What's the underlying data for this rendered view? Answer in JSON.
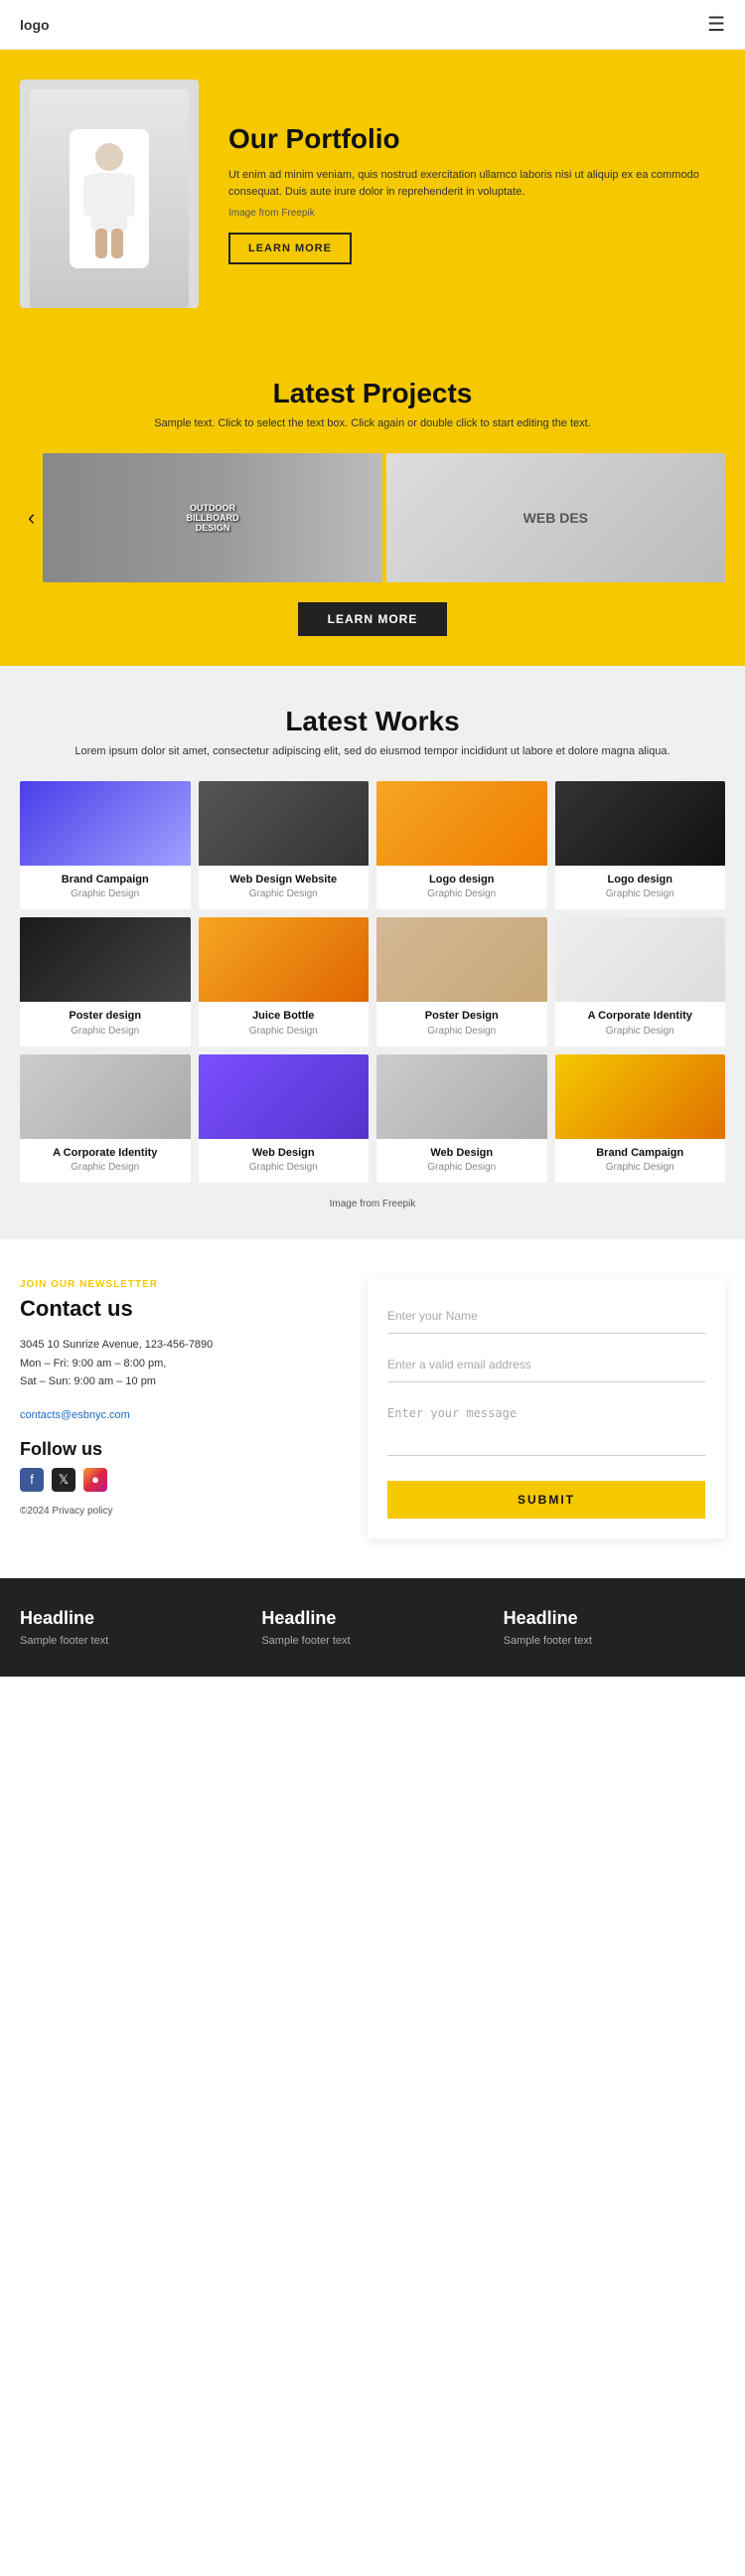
{
  "header": {
    "logo": "logo",
    "hamburger_icon": "☰"
  },
  "hero": {
    "title": "Our Portfolio",
    "text": "Ut enim ad minim veniam, quis nostrud exercitation ullamco laboris nisi ut aliquip ex ea commodo consequat. Duis aute irure dolor in reprehenderit in voluptate.",
    "freepik_text": "Image from Freepik",
    "button_label": "LEARN MORE"
  },
  "latest_projects": {
    "title": "Latest Projects",
    "subtitle": "Sample text. Click to select the text box. Click again or double click to start editing the text.",
    "button_label": "LEARN MORE"
  },
  "latest_works": {
    "title": "Latest Works",
    "subtitle": "Lorem ipsum dolor sit amet, consectetur adipiscing elit, sed do eiusmod tempor incididunt ut labore et dolore magna aliqua.",
    "freepik_text": "Image from Freepik",
    "cards": [
      {
        "title": "Brand Campaign",
        "sub": "Graphic Design",
        "img_class": "img-brand-campaign"
      },
      {
        "title": "Web Design Website",
        "sub": "Graphic Design",
        "img_class": "img-web-design-site"
      },
      {
        "title": "Logo design",
        "sub": "Graphic Design",
        "img_class": "img-logo-design"
      },
      {
        "title": "Logo design",
        "sub": "Graphic Design",
        "img_class": "img-logo-design2"
      },
      {
        "title": "Poster design",
        "sub": "Graphic Design",
        "img_class": "img-poster"
      },
      {
        "title": "Juice Bottle",
        "sub": "Graphic Design",
        "img_class": "img-juice"
      },
      {
        "title": "Poster Design",
        "sub": "Graphic Design",
        "img_class": "img-poster2"
      },
      {
        "title": "A Corporate Identity",
        "sub": "Graphic Design",
        "img_class": "img-corp-id"
      },
      {
        "title": "A Corporate Identity",
        "sub": "Graphic Design",
        "img_class": "img-corp-id2"
      },
      {
        "title": "Web Design",
        "sub": "Graphic Design",
        "img_class": "img-web-design2"
      },
      {
        "title": "Web Design",
        "sub": "Graphic Design",
        "img_class": "img-web-design3"
      },
      {
        "title": "Brand Campaign",
        "sub": "Graphic Design",
        "img_class": "img-brand-campaign2"
      }
    ]
  },
  "contact": {
    "tag": "JOIN OUR NEWSLETTER",
    "title": "Contact us",
    "address": "3045 10 Sunrize Avenue, 123-456-7890",
    "hours": "Mon – Fri: 9:00 am – 8:00 pm,",
    "hours2": "Sat – Sun: 9:00 am – 10 pm",
    "email": "contacts@esbnyc.com",
    "follow_title": "Follow us",
    "copyright": "©2024 Privacy policy",
    "name_placeholder": "Enter your Name",
    "email_placeholder": "Enter a valid email address",
    "message_placeholder": "Enter your message",
    "submit_label": "SUBMIT"
  },
  "footer": {
    "col1": {
      "title": "Headline",
      "text": "Sample footer text"
    },
    "col2": {
      "title": "Headline",
      "text": "Sample footer text"
    },
    "col3": {
      "title": "Headline",
      "text": "Sample footer text"
    }
  }
}
